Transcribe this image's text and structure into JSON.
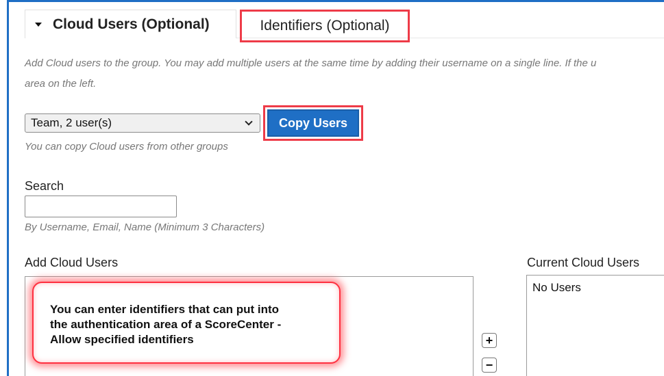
{
  "tabs": {
    "active_label": "Cloud Users (Optional)",
    "inactive_label": "Identifiers (Optional)"
  },
  "help": {
    "line1": "Add Cloud users to the group. You may add multiple users at the same time by adding their username on a single line. If the u",
    "line2": "area on the left."
  },
  "copy_users": {
    "group_selected": "Team, 2 user(s)",
    "button_label": "Copy Users",
    "note": "You can copy Cloud users from other groups"
  },
  "search": {
    "label": "Search",
    "value": "",
    "hint": "By Username, Email, Name (Minimum 3 Characters)"
  },
  "add_users": {
    "label": "Add Cloud Users"
  },
  "current_users": {
    "label": "Current Cloud Users",
    "empty_text": "No Users"
  },
  "callout": {
    "line1": "You can enter identifiers that can put into",
    "line2": "the authentication area of a ScoreCenter -",
    "line3": "Allow specified identifiers"
  },
  "controls": {
    "add_glyph": "+",
    "remove_glyph": "−"
  },
  "colors": {
    "accent_blue": "#1f6fc5",
    "highlight_red": "#ee3b48"
  }
}
